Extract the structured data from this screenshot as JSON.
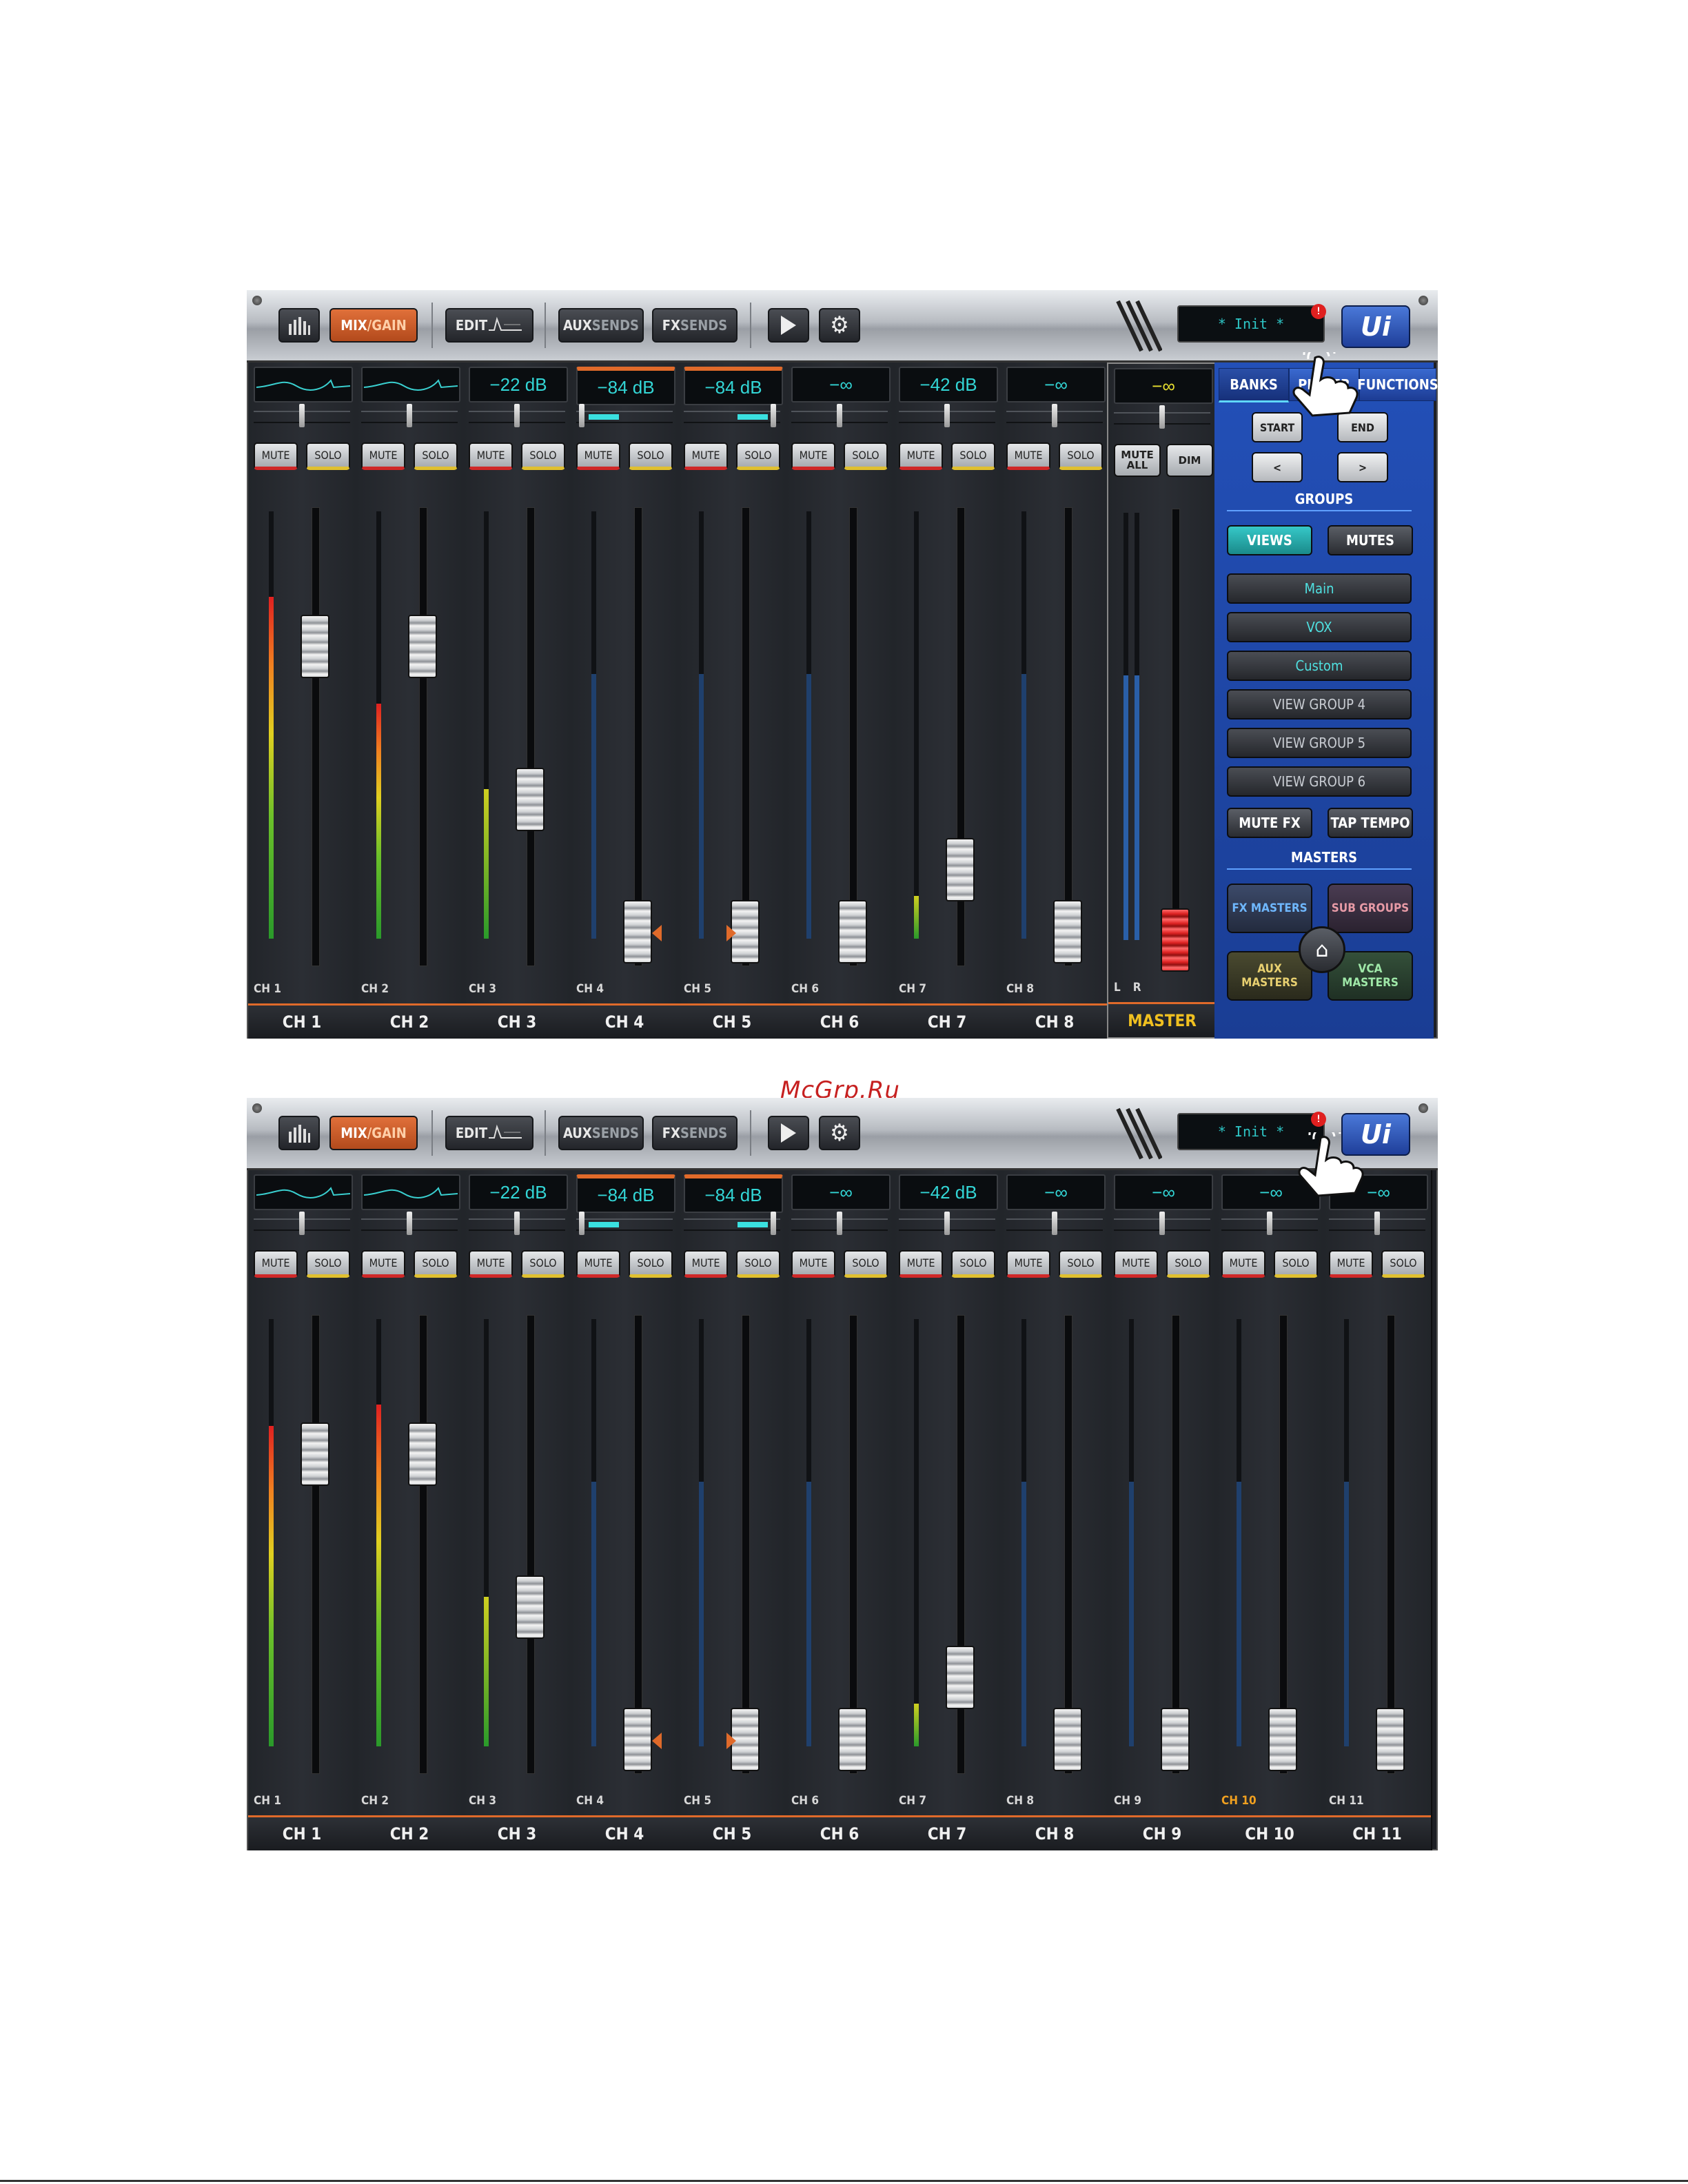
{
  "watermark": "McGrp.Ru",
  "toolbar": {
    "meter_icon": "meter-bars-icon",
    "mix_label_a": "MIX",
    "mix_label_b": "/GAIN",
    "edit_label": "EDIT",
    "aux_a": "AUX",
    "aux_b": "SENDS",
    "fx_a": "FX",
    "fx_b": "SENDS",
    "play_icon": "play-icon",
    "settings_icon": "gear-icon",
    "display_text": "* Init *",
    "alert_badge": "!",
    "logo": "Ui"
  },
  "screenA": {
    "channels": [
      {
        "lcd": "",
        "eq": true,
        "label": "CH 1",
        "name": "CH 1",
        "mute": "MUTE",
        "solo": "SOLO",
        "meter_level": 0.8,
        "fader": 0.74
      },
      {
        "lcd": "",
        "eq": true,
        "label": "CH 2",
        "name": "CH 2",
        "mute": "MUTE",
        "solo": "SOLO",
        "meter_level": 0.55,
        "fader": 0.74
      },
      {
        "lcd": "−22 dB",
        "eq": false,
        "label": "CH 3",
        "name": "CH 3",
        "mute": "MUTE",
        "solo": "SOLO",
        "meter_level": 0.35,
        "fader": 0.37
      },
      {
        "lcd": "−84 dB",
        "eq": false,
        "label": "CH 4",
        "name": "CH 4",
        "mute": "MUTE",
        "solo": "SOLO",
        "meter_level": 0.0,
        "fader": 0.05,
        "selected": true
      },
      {
        "lcd": "−84 dB",
        "eq": false,
        "label": "CH 5",
        "name": "CH 5",
        "mute": "MUTE",
        "solo": "SOLO",
        "meter_level": 0.0,
        "fader": 0.05,
        "selected": true
      },
      {
        "lcd": "−∞",
        "eq": false,
        "label": "CH 6",
        "name": "CH 6",
        "mute": "MUTE",
        "solo": "SOLO",
        "meter_level": 0.0,
        "fader": 0.05
      },
      {
        "lcd": "−42 dB",
        "eq": false,
        "label": "CH 7",
        "name": "CH 7",
        "mute": "MUTE",
        "solo": "SOLO",
        "meter_level": 0.1,
        "fader": 0.2
      },
      {
        "lcd": "−∞",
        "eq": false,
        "label": "CH 8",
        "name": "CH 8",
        "mute": "MUTE",
        "solo": "SOLO",
        "meter_level": 0.0,
        "fader": 0.05
      }
    ],
    "master": {
      "lcd": "−∞",
      "mute_all": "MUTE ALL",
      "dim": "DIM",
      "l": "L",
      "r": "R",
      "name": "MASTER"
    },
    "panel": {
      "tabs": [
        "BANKS",
        "PLAYER",
        "FUNCTIONS"
      ],
      "start": "START",
      "end": "END",
      "prev": "<",
      "next": ">",
      "groups_heading": "GROUPS",
      "views": "VIEWS",
      "mutes": "MUTES",
      "view_items": [
        "Main",
        "VOX",
        "Custom",
        "VIEW GROUP 4",
        "VIEW GROUP 5",
        "VIEW GROUP 6"
      ],
      "mute_fx": "MUTE FX",
      "tap_tempo": "TAP TEMPO",
      "masters_heading": "MASTERS",
      "fx_masters": "FX MASTERS",
      "sub_groups": "SUB GROUPS",
      "aux_masters": "AUX MASTERS",
      "vca_masters": "VCA MASTERS"
    }
  },
  "screenB": {
    "channels": [
      {
        "lcd": "",
        "eq": true,
        "label": "CH 1",
        "name": "CH 1",
        "mute": "MUTE",
        "solo": "SOLO",
        "meter_level": 0.75,
        "fader": 0.74
      },
      {
        "lcd": "",
        "eq": true,
        "label": "CH 2",
        "name": "CH 2",
        "mute": "MUTE",
        "solo": "SOLO",
        "meter_level": 0.8,
        "fader": 0.74
      },
      {
        "lcd": "−22 dB",
        "eq": false,
        "label": "CH 3",
        "name": "CH 3",
        "mute": "MUTE",
        "solo": "SOLO",
        "meter_level": 0.35,
        "fader": 0.37
      },
      {
        "lcd": "−84 dB",
        "eq": false,
        "label": "CH 4",
        "name": "CH 4",
        "mute": "MUTE",
        "solo": "SOLO",
        "meter_level": 0.0,
        "fader": 0.05,
        "selected": true
      },
      {
        "lcd": "−84 dB",
        "eq": false,
        "label": "CH 5",
        "name": "CH 5",
        "mute": "MUTE",
        "solo": "SOLO",
        "meter_level": 0.0,
        "fader": 0.05,
        "selected": true
      },
      {
        "lcd": "−∞",
        "eq": false,
        "label": "CH 6",
        "name": "CH 6",
        "mute": "MUTE",
        "solo": "SOLO",
        "meter_level": 0.0,
        "fader": 0.05
      },
      {
        "lcd": "−42 dB",
        "eq": false,
        "label": "CH 7",
        "name": "CH 7",
        "mute": "MUTE",
        "solo": "SOLO",
        "meter_level": 0.1,
        "fader": 0.2
      },
      {
        "lcd": "−∞",
        "eq": false,
        "label": "CH 8",
        "name": "CH 8",
        "mute": "MUTE",
        "solo": "SOLO",
        "meter_level": 0.0,
        "fader": 0.05
      },
      {
        "lcd": "−∞",
        "eq": false,
        "label": "CH 9",
        "name": "CH 9",
        "mute": "MUTE",
        "solo": "SOLO",
        "meter_level": 0.0,
        "fader": 0.05
      },
      {
        "lcd": "−∞",
        "eq": false,
        "label": "CH 10",
        "name": "CH 10",
        "mute": "MUTE",
        "solo": "SOLO",
        "meter_level": 0.0,
        "fader": 0.05,
        "highlight": true
      },
      {
        "lcd": "−∞",
        "eq": false,
        "label": "CH 11",
        "name": "CH 11",
        "mute": "MUTE",
        "solo": "SOLO",
        "meter_level": 0.0,
        "fader": 0.05
      }
    ]
  }
}
